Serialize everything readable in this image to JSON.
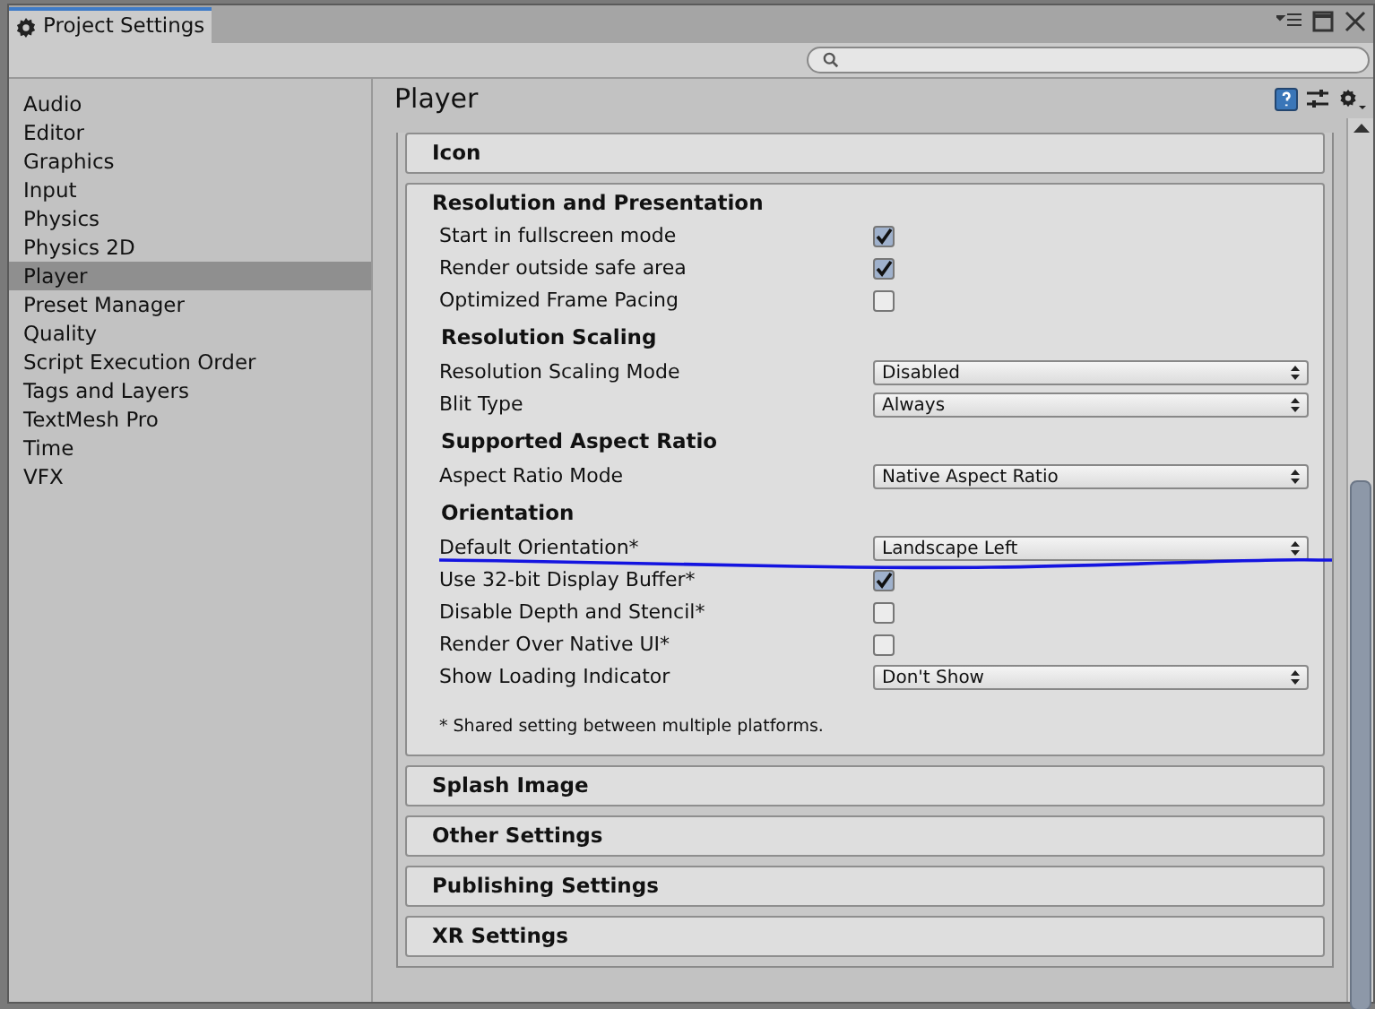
{
  "window": {
    "title": "Project Settings"
  },
  "sidebar": {
    "items": [
      {
        "label": "Audio",
        "selected": false
      },
      {
        "label": "Editor",
        "selected": false
      },
      {
        "label": "Graphics",
        "selected": false
      },
      {
        "label": "Input",
        "selected": false
      },
      {
        "label": "Physics",
        "selected": false
      },
      {
        "label": "Physics 2D",
        "selected": false
      },
      {
        "label": "Player",
        "selected": true
      },
      {
        "label": "Preset Manager",
        "selected": false
      },
      {
        "label": "Quality",
        "selected": false
      },
      {
        "label": "Script Execution Order",
        "selected": false
      },
      {
        "label": "Tags and Layers",
        "selected": false
      },
      {
        "label": "TextMesh Pro",
        "selected": false
      },
      {
        "label": "Time",
        "selected": false
      },
      {
        "label": "VFX",
        "selected": false
      }
    ]
  },
  "panel": {
    "title": "Player",
    "sections": [
      {
        "title": "Icon",
        "expanded": false
      },
      {
        "title": "Resolution and Presentation",
        "expanded": true,
        "rows": [
          {
            "kind": "checkbox",
            "label": "Start in fullscreen mode",
            "checked": true
          },
          {
            "kind": "checkbox",
            "label": "Render outside safe area",
            "checked": true
          },
          {
            "kind": "checkbox",
            "label": "Optimized Frame Pacing",
            "checked": false
          },
          {
            "kind": "header",
            "label": "Resolution Scaling"
          },
          {
            "kind": "dropdown",
            "label": "Resolution Scaling Mode",
            "value": "Disabled"
          },
          {
            "kind": "dropdown",
            "label": "Blit Type",
            "value": "Always"
          },
          {
            "kind": "header",
            "label": "Supported Aspect Ratio"
          },
          {
            "kind": "dropdown",
            "label": "Aspect Ratio Mode",
            "value": "Native Aspect Ratio"
          },
          {
            "kind": "header",
            "label": "Orientation"
          },
          {
            "kind": "dropdown",
            "label": "Default Orientation*",
            "value": "Landscape Left"
          },
          {
            "kind": "checkbox",
            "label": "Use 32-bit Display Buffer*",
            "checked": true
          },
          {
            "kind": "checkbox",
            "label": "Disable Depth and Stencil*",
            "checked": false
          },
          {
            "kind": "checkbox",
            "label": "Render Over Native UI*",
            "checked": false
          },
          {
            "kind": "dropdown",
            "label": "Show Loading Indicator",
            "value": "Don't Show"
          },
          {
            "kind": "note",
            "label": "* Shared setting between multiple platforms."
          }
        ]
      },
      {
        "title": "Splash Image",
        "expanded": false
      },
      {
        "title": "Other Settings",
        "expanded": false
      },
      {
        "title": "Publishing Settings",
        "expanded": false
      },
      {
        "title": "XR Settings",
        "expanded": false
      }
    ]
  }
}
